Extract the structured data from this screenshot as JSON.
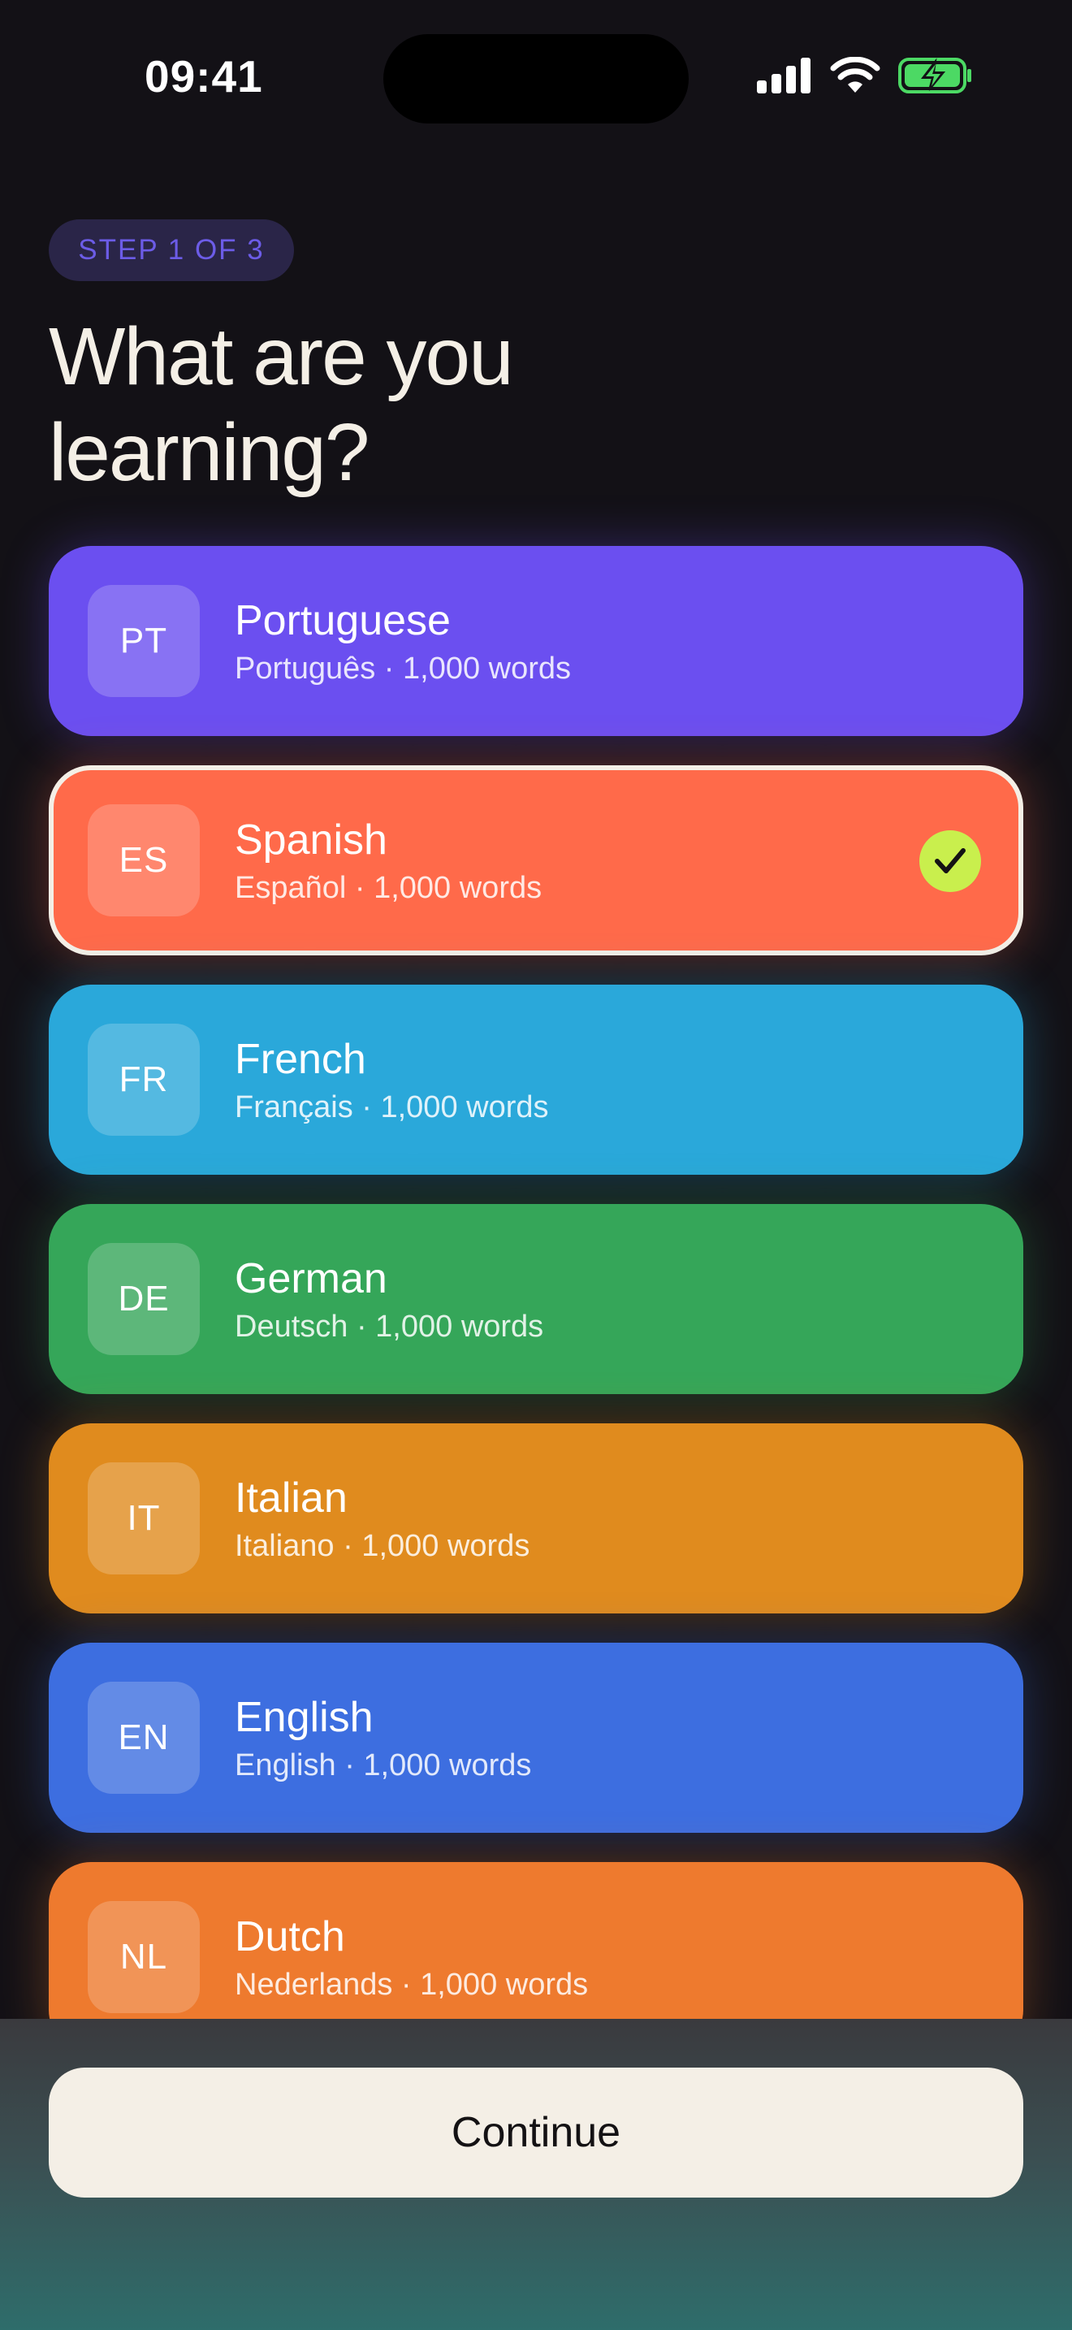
{
  "status_bar": {
    "time": "09:41",
    "icons": [
      "signal-icon",
      "wifi-icon",
      "battery-charging-icon"
    ]
  },
  "header": {
    "step_label": "STEP 1 OF 3",
    "title": "What are you learning?"
  },
  "languages": [
    {
      "code": "PT",
      "name": "Portuguese",
      "subtitle": "Português · 1,000 words",
      "color": "#6b4ff0",
      "selected": false
    },
    {
      "code": "ES",
      "name": "Spanish",
      "subtitle": "Español · 1,000 words",
      "color": "#ff6a4a",
      "selected": true
    },
    {
      "code": "FR",
      "name": "French",
      "subtitle": "Français · 1,000 words",
      "color": "#2aa8da",
      "selected": false
    },
    {
      "code": "DE",
      "name": "German",
      "subtitle": "Deutsch · 1,000 words",
      "color": "#35a659",
      "selected": false
    },
    {
      "code": "IT",
      "name": "Italian",
      "subtitle": "Italiano · 1,000 words",
      "color": "#e08b1e",
      "selected": false
    },
    {
      "code": "EN",
      "name": "English",
      "subtitle": "English · 1,000 words",
      "color": "#3d6ee0",
      "selected": false
    },
    {
      "code": "NL",
      "name": "Dutch",
      "subtitle": "Nederlands · 1,000 words",
      "color": "#ee7a2e",
      "selected": false
    }
  ],
  "selected_indicator": {
    "icon": "checkmark-icon",
    "color": "#c9ef4d"
  },
  "footer": {
    "continue_label": "Continue"
  }
}
